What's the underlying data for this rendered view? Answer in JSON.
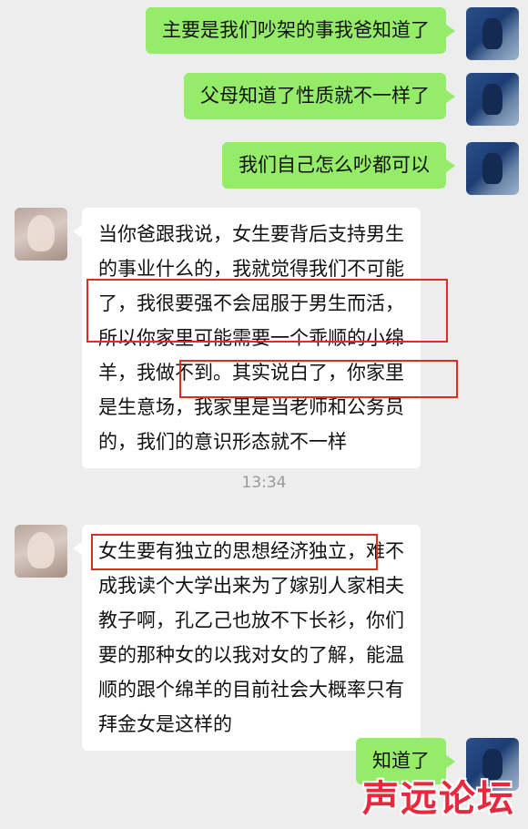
{
  "messages": [
    {
      "side": "self",
      "text": "主要是我们吵架的事我爸知道了"
    },
    {
      "side": "self",
      "text": "父母知道了性质就不一样了"
    },
    {
      "side": "self",
      "text": "我们自己怎么吵都可以"
    },
    {
      "side": "other",
      "lines": [
        "当你爸跟我说，女生要背后支持男生",
        "的事业什么的，我就觉得我们不可能",
        "了，我很要强不会屈服于男生而活，",
        "所以你家里可能需要一个乖顺的小绵",
        "羊，我做不到。其实说白了，你家里",
        "是生意场，我家里是当老师和公务员",
        "的，我们的意识形态就不一样"
      ]
    },
    {
      "side": "other",
      "lines": [
        "女生要有独立的思想经济独立，难不",
        "成我读个大学出来为了嫁别人家相夫",
        "教子啊，孔乙己也放不下长衫，你们",
        "要的那种女的以我对女的了解，能温",
        "顺的跟个绵羊的目前社会大概率只有",
        "拜金女是这样的"
      ]
    },
    {
      "side": "self",
      "text": "知道了"
    }
  ],
  "timestamp": "13:34",
  "watermark": "声远论坛",
  "colors": {
    "self_bubble": "#95ec69",
    "other_bubble": "#ffffff",
    "background": "#ededed",
    "highlight_box": "#d93025"
  }
}
